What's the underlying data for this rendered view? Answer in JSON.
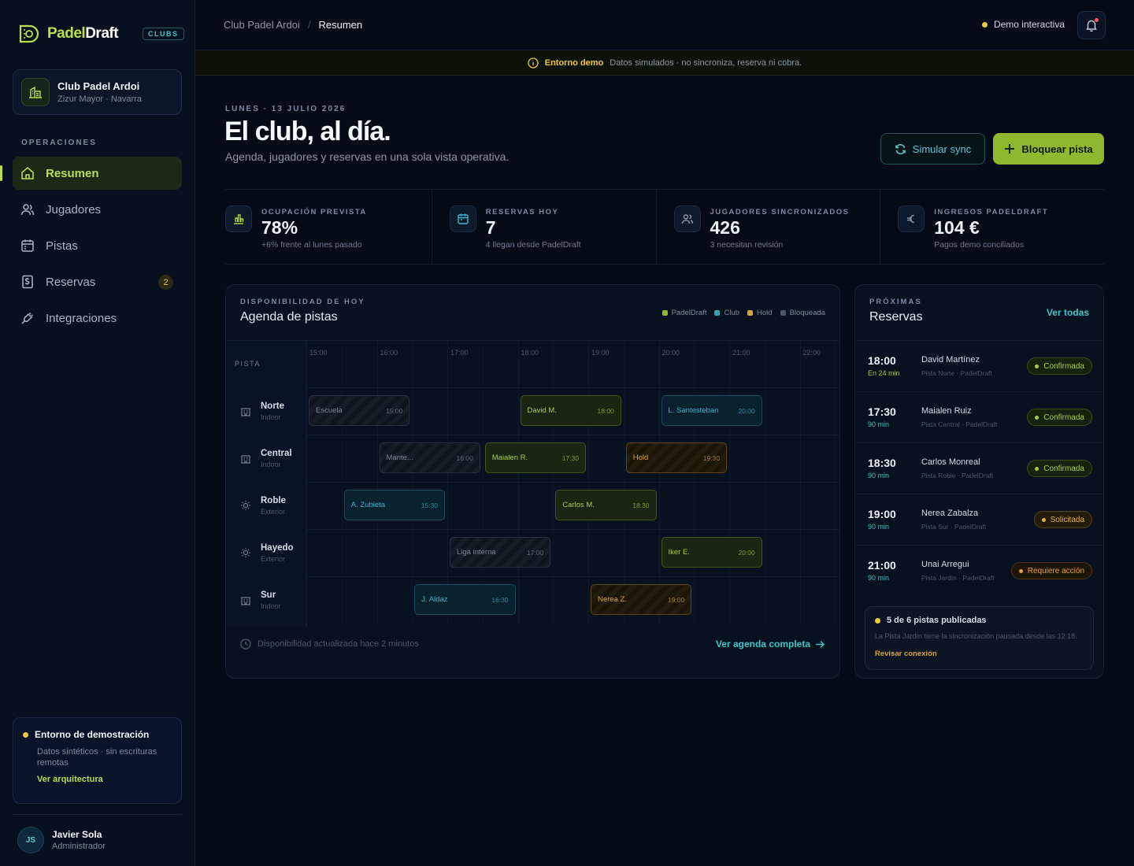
{
  "brand": {
    "logo_text_a": "Padel",
    "logo_text_b": "Draft",
    "badge": "CLUBS"
  },
  "club": {
    "name": "Club Padel Ardoi",
    "location": "Zizur Mayor · Navarra"
  },
  "sidebar": {
    "section": "OPERACIONES",
    "items": [
      {
        "label": "Resumen",
        "icon": "home-icon"
      },
      {
        "label": "Jugadores",
        "icon": "users-icon"
      },
      {
        "label": "Pistas",
        "icon": "calendar-icon"
      },
      {
        "label": "Reservas",
        "icon": "receipt-icon",
        "badge": "2"
      },
      {
        "label": "Integraciones",
        "icon": "plug-icon"
      }
    ],
    "demo": {
      "title": "Entorno de demostración",
      "desc": "Datos sintéticos · sin escrituras remotas",
      "link": "Ver arquitectura"
    },
    "user": {
      "initials": "JS",
      "name": "Javier Sola",
      "role": "Administrador"
    }
  },
  "header": {
    "breadcrumb": [
      "Club Padel Ardoi",
      "Resumen"
    ],
    "demo_pill": "Demo interactiva"
  },
  "banner": {
    "label": "Entorno demo",
    "text": "Datos simulados · no sincroniza, reserva ni cobra."
  },
  "hero": {
    "date": "LUNES · 13 JULIO 2026",
    "title": "El club, al día.",
    "subtitle": "Agenda, jugadores y reservas en una sola vista operativa.",
    "sync_label": "Simular sync",
    "block_label": "Bloquear pista"
  },
  "kpis": [
    {
      "label": "OCUPACIÓN PREVISTA",
      "value": "78%",
      "note": "+6% frente al lunes pasado",
      "icon": "bar-chart-icon"
    },
    {
      "label": "RESERVAS HOY",
      "value": "7",
      "note": "4 llegan desde PadelDraft",
      "icon": "calendar-icon"
    },
    {
      "label": "JUGADORES SINCRONIZADOS",
      "value": "426",
      "note": "3 necesitan revisión",
      "icon": "users-icon"
    },
    {
      "label": "INGRESOS PADELDRAFT",
      "value": "104 €",
      "note": "Pagos demo conciliados",
      "icon": "euro-icon"
    }
  ],
  "agenda": {
    "kicker": "DISPONIBILIDAD DE HOY",
    "title": "Agenda de pistas",
    "legend": [
      {
        "label": "PadelDraft",
        "color": "#8fb82e"
      },
      {
        "label": "Club",
        "color": "#2aa6b8"
      },
      {
        "label": "Hold",
        "color": "#d6a63a"
      },
      {
        "label": "Bloqueada",
        "color": "#4c586e"
      }
    ],
    "column_header": "PISTA",
    "hours": [
      "15:00",
      "16:00",
      "17:00",
      "18:00",
      "19:00",
      "20:00",
      "21:00",
      "22:00"
    ],
    "courts": [
      {
        "name": "Norte",
        "type": "Indoor",
        "icon": "building-icon"
      },
      {
        "name": "Central",
        "type": "Indoor",
        "icon": "building-icon"
      },
      {
        "name": "Roble",
        "type": "Exterior",
        "icon": "sun-icon"
      },
      {
        "name": "Hayedo",
        "type": "Exterior",
        "icon": "sun-icon"
      },
      {
        "name": "Sur",
        "type": "Indoor",
        "icon": "building-icon"
      }
    ],
    "slots": [
      {
        "court": 0,
        "start": "15:00",
        "label": "Escuela",
        "kind": "blk"
      },
      {
        "court": 0,
        "start": "18:00",
        "label": "David M.",
        "kind": "pd"
      },
      {
        "court": 0,
        "start": "20:00",
        "label": "L. Santesteban",
        "kind": "club"
      },
      {
        "court": 1,
        "start": "16:00",
        "label": "Mante...",
        "kind": "blk"
      },
      {
        "court": 1,
        "start": "17:30",
        "label": "Maialen R.",
        "kind": "pd"
      },
      {
        "court": 1,
        "start": "19:30",
        "label": "Hold",
        "kind": "hold"
      },
      {
        "court": 2,
        "start": "15:30",
        "label": "A. Zubieta",
        "kind": "club"
      },
      {
        "court": 2,
        "start": "18:30",
        "label": "Carlos M.",
        "kind": "pd"
      },
      {
        "court": 3,
        "start": "17:00",
        "label": "Liga interna",
        "kind": "blk"
      },
      {
        "court": 3,
        "start": "20:00",
        "label": "Iker E.",
        "kind": "pd"
      },
      {
        "court": 4,
        "start": "16:30",
        "label": "J. Aldaz",
        "kind": "club"
      },
      {
        "court": 4,
        "start": "19:00",
        "label": "Nerea Z.",
        "kind": "hold"
      }
    ],
    "footer": "Disponibilidad actualizada hace 2 minutos",
    "link": "Ver agenda completa"
  },
  "reservas": {
    "kicker": "PRÓXIMAS",
    "title": "Reservas",
    "all": "Ver todas",
    "items": [
      {
        "time": "18:00",
        "dur": "En 24 min",
        "name": "David Martínez",
        "place": "Pista Norte · PadelDraft",
        "status": "Confirmada",
        "kind": "ok"
      },
      {
        "time": "17:30",
        "dur": "90 min",
        "name": "Maialen Ruiz",
        "place": "Pista Central · PadelDraft",
        "status": "Confirmada",
        "kind": "ok"
      },
      {
        "time": "18:30",
        "dur": "90 min",
        "name": "Carlos Monreal",
        "place": "Pista Roble · PadelDraft",
        "status": "Confirmada",
        "kind": "ok"
      },
      {
        "time": "19:00",
        "dur": "90 min",
        "name": "Nerea Zabalza",
        "place": "Pista Sur · PadelDraft",
        "status": "Solicitada",
        "kind": "req"
      },
      {
        "time": "21:00",
        "dur": "90 min",
        "name": "Unai Arregui",
        "place": "Pista Jardín · PadelDraft",
        "status": "Requiere acción",
        "kind": "act"
      }
    ],
    "notice": {
      "title": "5 de 6 pistas publicadas",
      "desc": "La Pista Jardín tiene la sincronización pausada desde las 12:18.",
      "link": "Revisar conexión"
    }
  }
}
